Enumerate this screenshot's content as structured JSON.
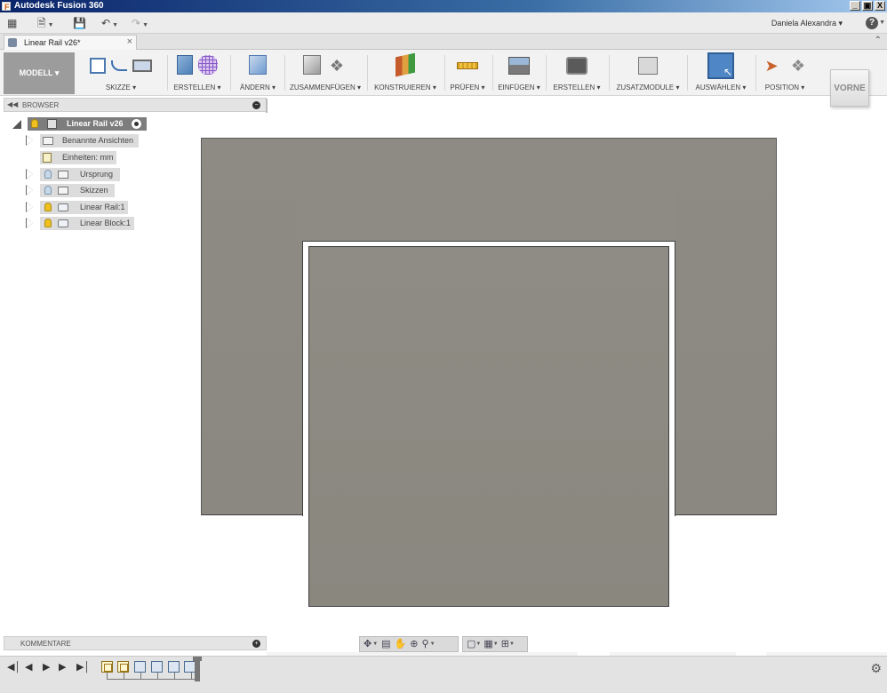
{
  "window": {
    "title": "Autodesk Fusion 360",
    "controls": [
      "_",
      "▣",
      "X"
    ]
  },
  "quickbar": {
    "icons": [
      "apps-grid-icon",
      "file-icon",
      "save-icon",
      "undo-icon",
      "redo-icon"
    ],
    "user": "Daniela Alexandra ▾",
    "help": "?"
  },
  "document": {
    "tab_label": "Linear Rail v26*",
    "tab_close": "×"
  },
  "toolbar": {
    "mode": "MODELL ▾",
    "groups": [
      {
        "label": "SKIZZE ▾"
      },
      {
        "label": "ERSTELLEN ▾"
      },
      {
        "label": "ÄNDERN ▾"
      },
      {
        "label": "ZUSAMMENFÜGEN ▾"
      },
      {
        "label": "KONSTRUIEREN ▾"
      },
      {
        "label": "PRÜFEN ▾"
      },
      {
        "label": "EINFÜGEN ▾"
      },
      {
        "label": "ERSTELLEN ▾"
      },
      {
        "label": "ZUSATZMODULE ▾"
      },
      {
        "label": "AUSWÄHLEN ▾"
      },
      {
        "label": "POSITION ▾"
      }
    ]
  },
  "viewcube": {
    "face": "VORNE"
  },
  "browser": {
    "title": "BROWSER",
    "root": "Linear Rail v26",
    "items": [
      {
        "label": "Benannte Ansichten",
        "bulb": "none",
        "icon": "folder"
      },
      {
        "label": "Einheiten: mm",
        "bulb": "none",
        "icon": "document"
      },
      {
        "label": "Ursprung",
        "bulb": "off",
        "icon": "folder"
      },
      {
        "label": "Skizzen",
        "bulb": "off",
        "icon": "folder"
      },
      {
        "label": "Linear Rail:1",
        "bulb": "on",
        "icon": "component"
      },
      {
        "label": "Linear Block:1",
        "bulb": "on",
        "icon": "component"
      }
    ]
  },
  "comments": {
    "title": "KOMMENTARE"
  },
  "navbar": {
    "tools": [
      "orbit-icon",
      "look-at-icon",
      "pan-icon",
      "zoom-window-icon",
      "zoom-icon"
    ],
    "display": [
      "display-settings-icon",
      "grid-icon",
      "viewports-icon"
    ]
  },
  "timeline": {
    "playback": [
      "⏮",
      "⏴",
      "▶",
      "⏭"
    ],
    "features": [
      "sketch",
      "sketch",
      "body",
      "body",
      "body",
      "body"
    ]
  }
}
